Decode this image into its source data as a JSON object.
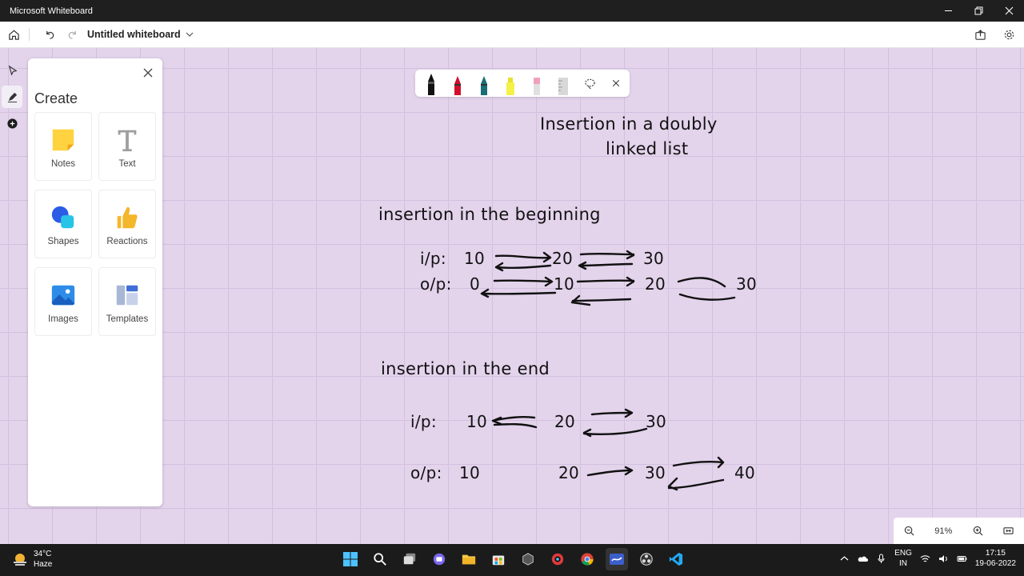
{
  "app": {
    "window_title": "Microsoft Whiteboard"
  },
  "toolbar": {
    "doc_title": "Untitled whiteboard"
  },
  "create_panel": {
    "title": "Create",
    "items": [
      {
        "label": "Notes",
        "icon": "sticky-note-icon"
      },
      {
        "label": "Text",
        "icon": "text-icon"
      },
      {
        "label": "Shapes",
        "icon": "shapes-icon"
      },
      {
        "label": "Reactions",
        "icon": "thumbs-up-icon"
      },
      {
        "label": "Images",
        "icon": "image-icon"
      },
      {
        "label": "Templates",
        "icon": "templates-icon"
      }
    ]
  },
  "pen_tray": {
    "pens": [
      "black",
      "red",
      "teal",
      "yellow",
      "pink"
    ],
    "colors": {
      "black": "#111111",
      "red": "#d0102c",
      "teal": "#1a6e78",
      "yellow": "#f5f04a",
      "pink": "#f0a0b8"
    }
  },
  "board": {
    "heading_line1": "Insertion in a doubly",
    "heading_line2": "linked list",
    "section1": {
      "title": "insertion in the beginning",
      "ip_label": "i/p:",
      "ip_values": [
        "10",
        "20",
        "30"
      ],
      "op_label": "o/p:",
      "op_values": [
        "0",
        "10",
        "20",
        "30"
      ]
    },
    "section2": {
      "title": "insertion in the end",
      "ip_label": "i/p:",
      "ip_values": [
        "10",
        "20",
        "30"
      ],
      "op_label": "o/p:",
      "op_values": [
        "10",
        "20",
        "30",
        "40"
      ]
    }
  },
  "zoom": {
    "level": "91%"
  },
  "taskbar": {
    "temperature": "34°C",
    "condition": "Haze",
    "lang_line1": "ENG",
    "lang_line2": "IN",
    "time": "17:15",
    "date": "19-06-2022"
  },
  "colors": {
    "canvas": "#e3d3eb",
    "grid": "#d4c0e0",
    "accent": "#5b2d90"
  }
}
